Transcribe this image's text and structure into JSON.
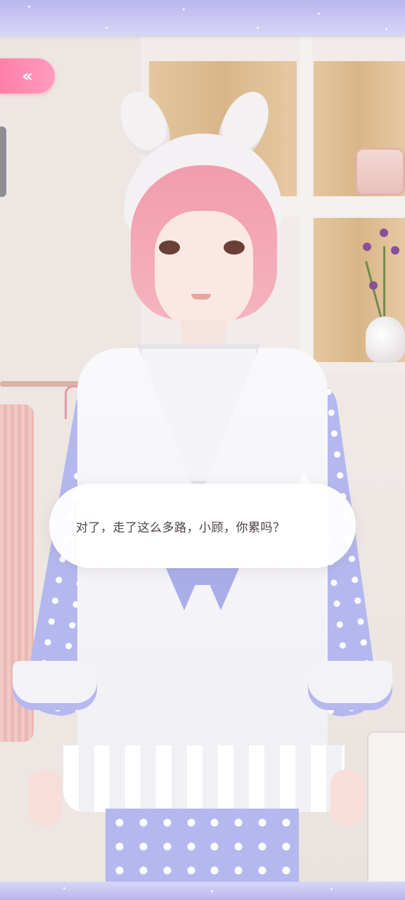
{
  "dialog": {
    "text": "对了，走了这么多路，小顾，你累吗？"
  },
  "back_button": {
    "icon": "double-chevron-left-icon",
    "glyph": "«",
    "color": "#ff8fb3"
  },
  "theme": {
    "top_bar_color": "#c7c5f3",
    "dialog_bg": "#ffffff",
    "text_color": "#4b3f3f"
  }
}
